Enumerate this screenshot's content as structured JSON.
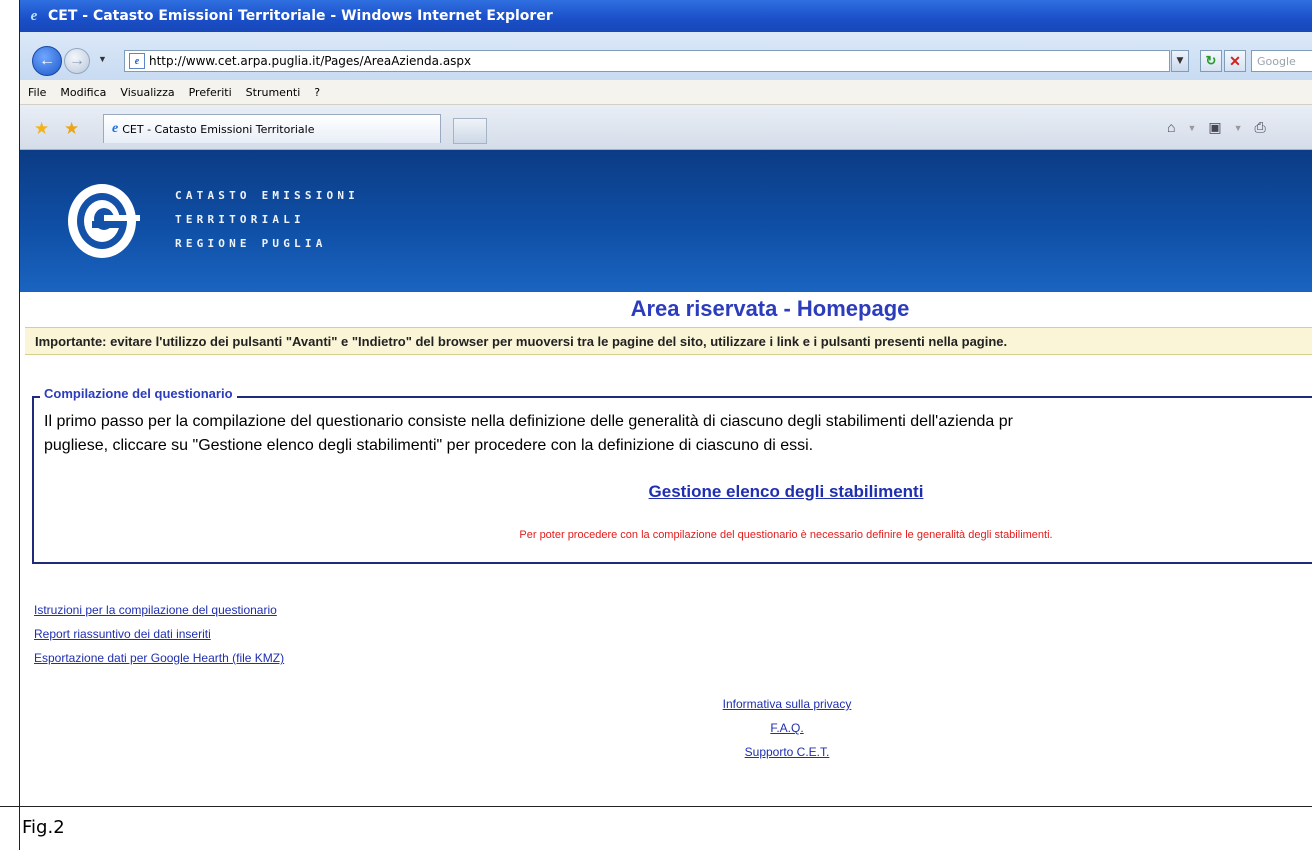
{
  "window": {
    "title": "CET - Catasto Emissioni Territoriale - Windows Internet Explorer"
  },
  "addressbar": {
    "url": "http://www.cet.arpa.puglia.it/Pages/AreaAzienda.aspx",
    "search_placeholder": "Google"
  },
  "menu": {
    "items": [
      "File",
      "Modifica",
      "Visualizza",
      "Preferiti",
      "Strumenti",
      "?"
    ]
  },
  "tabs": {
    "active_label": "CET - Catasto Emissioni Territoriale"
  },
  "banner": {
    "line1": "Catasto Emissioni",
    "line2": "Territoriali",
    "line3": "Regione Puglia"
  },
  "page": {
    "title": "Area riservata - Homepage",
    "warning": "Importante: evitare l'utilizzo dei pulsanti \"Avanti\" e \"Indietro\" del browser per muoversi tra le pagine del sito, utilizzare i link e i pulsanti presenti nella pagine.",
    "section_legend": "Compilazione del questionario",
    "para_line1": "Il primo passo per la compilazione del questionario consiste nella definizione delle generalità di ciascuno degli stabilimenti dell'azienda pr",
    "para_line2": "pugliese, cliccare su \"Gestione elenco degli stabilimenti\" per procedere con la definizione di ciascuno di essi.",
    "gestione_link": "Gestione elenco degli stabilimenti",
    "red_message": "Per poter procedere con la compilazione del questionario è necessario definire le generalità degli stabilimenti."
  },
  "left_links": [
    "Istruzioni per la compilazione del questionario",
    "Report riassuntivo dei dati inseriti",
    "Esportazione dati per Google Hearth (file KMZ)"
  ],
  "center_links": [
    "Informativa sulla privacy",
    "F.A.Q.",
    "Supporto C.E.T."
  ],
  "caption": "Fig.2",
  "colors": {
    "banner": "#0f4fa6",
    "link": "#1f2fb0",
    "title": "#2b3cbd",
    "red": "#e31b1b"
  }
}
